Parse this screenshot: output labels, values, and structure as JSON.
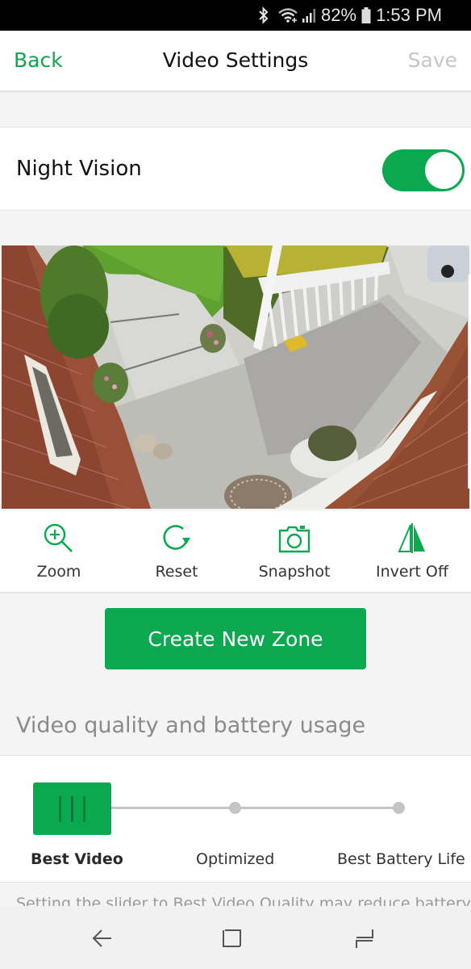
{
  "status_bar": {
    "battery": "82%",
    "time": "1:53 PM",
    "icons": [
      "bluetooth-icon",
      "wifi-icon",
      "signal-icon",
      "battery-icon"
    ]
  },
  "header": {
    "back_label": "Back",
    "title": "Video Settings",
    "save_label": "Save"
  },
  "night_vision": {
    "label": "Night Vision",
    "enabled": true
  },
  "camera": {
    "description": "Live camera view of front porch and walkway"
  },
  "tools": [
    {
      "label": "Zoom",
      "icon": "zoom-in-icon"
    },
    {
      "label": "Reset",
      "icon": "reset-icon"
    },
    {
      "label": "Snapshot",
      "icon": "camera-icon"
    },
    {
      "label": "Invert Off",
      "icon": "invert-icon"
    }
  ],
  "create_zone_label": "Create New Zone",
  "quality": {
    "section_title": "Video quality and battery usage",
    "options": [
      "Best Video",
      "Optimized",
      "Best Battery Life"
    ],
    "selected_index": 0,
    "note": "Setting the slider to Best Video Quality may reduce battery"
  },
  "colors": {
    "accent": "#0aa84f",
    "accent_dark": "#087a3a",
    "disabled": "#c6c6c6"
  },
  "navbar": {
    "buttons": [
      "back-nav-icon",
      "home-nav-icon",
      "recents-nav-icon"
    ]
  }
}
